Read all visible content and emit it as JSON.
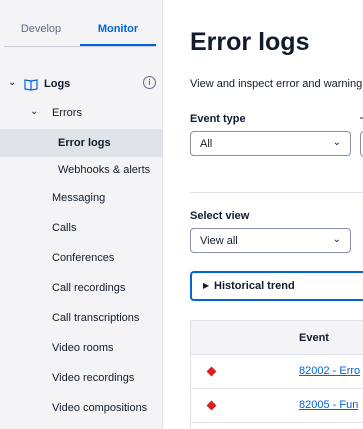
{
  "sidebar": {
    "tabs": {
      "develop": "Develop",
      "monitor": "Monitor"
    },
    "logs": {
      "label": "Logs",
      "info_glyph": "i"
    },
    "errors": {
      "label": "Errors"
    },
    "error_items": [
      "Error logs",
      "Webhooks & alerts"
    ],
    "items": [
      "Messaging",
      "Calls",
      "Conferences",
      "Call recordings",
      "Call transcriptions",
      "Video rooms",
      "Video recordings",
      "Video compositions"
    ]
  },
  "main": {
    "title": "Error logs",
    "subtitle": "View and inspect error and warning",
    "event_type": {
      "label": "Event type",
      "value": "All"
    },
    "select_view": {
      "label": "Select view",
      "value": "View all"
    },
    "historical_trend": "Historical trend",
    "table": {
      "column_event": "Event",
      "rows": [
        {
          "event": "82002 - Erro",
          "severity_color": "#d61f1f"
        },
        {
          "event": "82005 - Fun",
          "severity_color": "#d61f1f"
        }
      ]
    }
  },
  "colors": {
    "accent": "#0263e0",
    "error": "#d61f1f",
    "text": "#121c2d",
    "sidebar_bg": "#f4f4f6"
  }
}
